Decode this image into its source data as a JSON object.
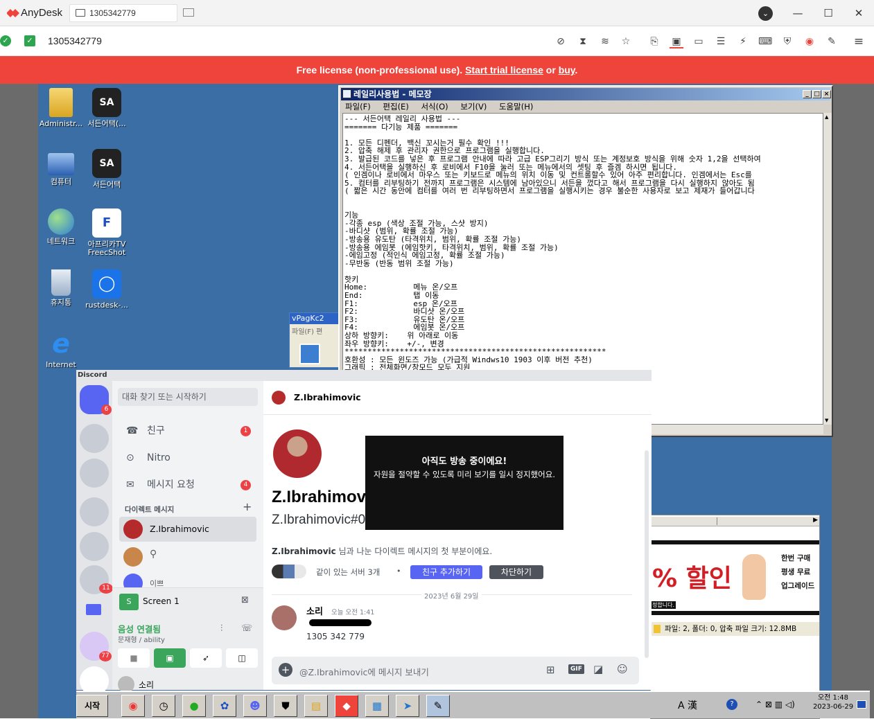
{
  "anydesk": {
    "app_name": "AnyDesk",
    "tab_label": "1305342779",
    "address": "1305342779",
    "banner_prefix": "Free license (non-professional use). ",
    "banner_trial_link": "Start trial license",
    "banner_or": " or ",
    "banner_buy_link": "buy",
    "banner_suffix": ".",
    "accent_color": "#ef443b"
  },
  "desktop": {
    "icons": [
      {
        "label": "Administr..."
      },
      {
        "label": "서든어택(..."
      },
      {
        "label": "컴퓨터"
      },
      {
        "label": "서든어택"
      },
      {
        "label": "네트워크"
      },
      {
        "label": "아프리카TV FreecShot"
      },
      {
        "label": "휴지통"
      },
      {
        "label": "rustdesk-..."
      },
      {
        "label": "Internet"
      }
    ]
  },
  "notepad": {
    "title": "레일리사용법 - 메모장",
    "menu": [
      "파일(F)",
      "편집(E)",
      "서식(O)",
      "보기(V)",
      "도움말(H)"
    ],
    "content": "--- 서든어택 레일리 사용법 ---\n======= 다기능 제품 =======\n\n1. 모든 디펜더, 백신 꼬시는거 필수 확인 !!!\n2. 압축 해제 후 관리자 권한으로 프로그램을 실행합니다.\n3. 발급된 코드를 넣은 후 프로그램 안내에 따라 고급 ESP그리기 방식 또는 계정보호 방식을 위해 숫자 1,2을 선택하여\n4. 서든어택을 실행하신 후 로비에서 F10을 눌러 또는 메뉴에서의 셋팅 후 즐겜 하시면 됩니다.\n( 인겜이나 로비에서 마우스 또는 키보드로 메뉴의 위치 이동 및 컨트롤할수 있어 아주 편리합니다. 인겜에서는 Esc를 \n5. 컴터를 리부팅하기 전까지 프로그램은 시스템에 남아있으니 서든을 껐다고 해서 프로그램을 다시 실행하지 않아도 됨\n( 짧은 시간 동안에 컴터를 여러 번 리부팅하면서 프로그램을 실행시키는 경우 불순한 사용자로 보고 제재가 들어갑니다\n\n\n기능\n-각종 esp (색상 조절 가능, 스샷 방지)\n-바디샷 (범위, 확률 조절 가능)\n-방송용 유도탄 (타격위치, 범위, 확률 조절 가능)\n-방송용 에임봇 (에임핫키, 타격위치, 범위, 확률 조절 가능)\n-에임고정 (적인식 에임고정, 확률 조절 가능)\n-무반동 (반동 범위 조절 가능)\n\n핫키\nHome:          메뉴 온/오프\nEnd:           탭 이동\nF1:            esp 온/오프\nF2:            바디샷 온/오프\nF3:            유도탄 온/오프\nF4:            에임봇 온/오프\n상하 방향키:    위 아래로 이동\n좌우 방향키:    +/-, 변경\n*********************************************************\n호환성 : 모든 윈도즈 가능 (가급적 Windws10 1903 이후 버전 추천)\n그래픽 : 전체화면/창모드 모두 지원"
  },
  "vpag": {
    "title": "vPagKc2",
    "menu": "파일(F) 편"
  },
  "discord": {
    "brand": "Discord",
    "search_placeholder": "대화 찾기 또는 시작하기",
    "home_badge": "6",
    "server_badge": "11",
    "server_badge2": "77",
    "nav": [
      {
        "label": "친구",
        "badge": "1"
      },
      {
        "label": "Nitro",
        "badge": ""
      },
      {
        "label": "메시지 요청",
        "badge": "4"
      }
    ],
    "dm_header": "다이렉트 메시지",
    "dm_list": [
      {
        "label": "Z.Ibrahimovic"
      },
      {
        "label": ""
      },
      {
        "label": "이쁘"
      }
    ],
    "screen_share": "Screen 1",
    "voice_status": "음성 연결됨",
    "voice_channel": "문재형 / ability",
    "channel_title": "Z.Ibrahimovic",
    "profile_name": "Z.Ibrahimovic",
    "profile_tag": "Z.Ibrahimovic#0789",
    "intro_name": "Z.Ibrahimovic",
    "intro_text": " 님과 나눈 다이렉트 메시지의 첫 부분이에요.",
    "mutual_servers": "같이 있는 서버 3개",
    "add_friend_btn": "친구 추가하기",
    "block_btn": "차단하기",
    "date_divider": "2023년 6월 29일",
    "msg_author": "소리",
    "msg_time": "오늘 오전 1:41",
    "msg_line2": "1305 342 779",
    "composer_placeholder": "@Z.Ibrahimovic에 메시지 보내기",
    "stream_title": "아직도 방송 중이에요!",
    "stream_sub": "자원을 절약할 수 있도록 미리 보기를 일시 정지했어요.",
    "user_footer": "소리"
  },
  "zip": {
    "ad_text": "% 할인",
    "ad_right": [
      "한번 구매",
      "평생 무료",
      "업그레이드"
    ],
    "status": "파일: 2, 폴더: 0, 압축 파일 크기: 12.8MB",
    "strip": "정합니다."
  },
  "taskbar": {
    "start": "시작",
    "ime": "A 漢",
    "time": "오전 1:48",
    "date": "2023-06-29"
  }
}
